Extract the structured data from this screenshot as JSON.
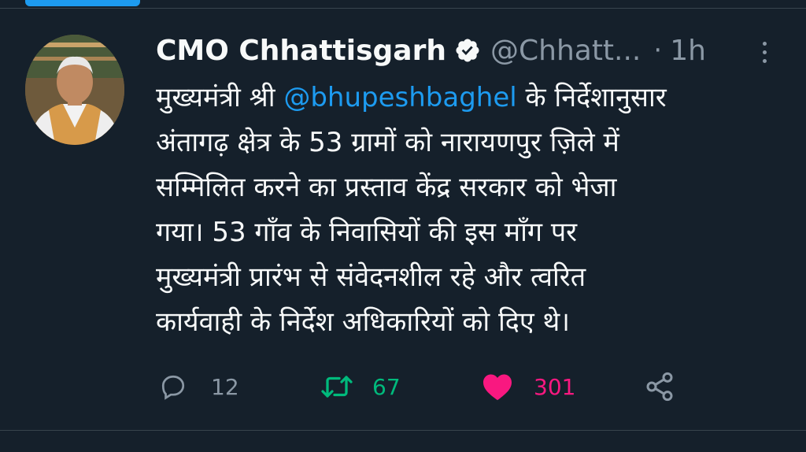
{
  "tweet": {
    "author_name": "CMO Chhattisgarh",
    "author_handle": "@Chhatt...",
    "separator": "·",
    "timestamp": "1h",
    "text_lines": [
      [
        {
          "text": "मुख्यमंत्री श्री "
        },
        {
          "text": "@bhupeshbaghel",
          "mention": true
        },
        {
          "text": " के निर्देशानुसार"
        }
      ],
      [
        {
          "text": "अंतागढ़ क्षेत्र के 53 ग्रामों को नारायणपुर ज़िले में"
        }
      ],
      [
        {
          "text": "सम्मिलित करने का प्रस्ताव  केंद्र सरकार को भेजा"
        }
      ],
      [
        {
          "text": "गया। 53 गाँव के निवासियों की इस माँग पर"
        }
      ],
      [
        {
          "text": "मुख्यमंत्री प्रारंभ से संवेदनशील रहे और त्वरित"
        }
      ],
      [
        {
          "text": "कार्यवाही के निर्देश अधिकारियों को दिए थे।"
        }
      ]
    ]
  },
  "actions": {
    "reply": {
      "icon": "reply-icon",
      "count": "12"
    },
    "retweet": {
      "icon": "retweet-icon",
      "count": "67",
      "color": "#00ba7c"
    },
    "like": {
      "icon": "heart-icon",
      "count": "301",
      "color": "#f91880"
    },
    "share": {
      "icon": "share-icon"
    }
  },
  "colors": {
    "background": "#15202b",
    "text": "#f7f9f9",
    "muted": "#8b98a5",
    "accent": "#1d9bf0"
  }
}
